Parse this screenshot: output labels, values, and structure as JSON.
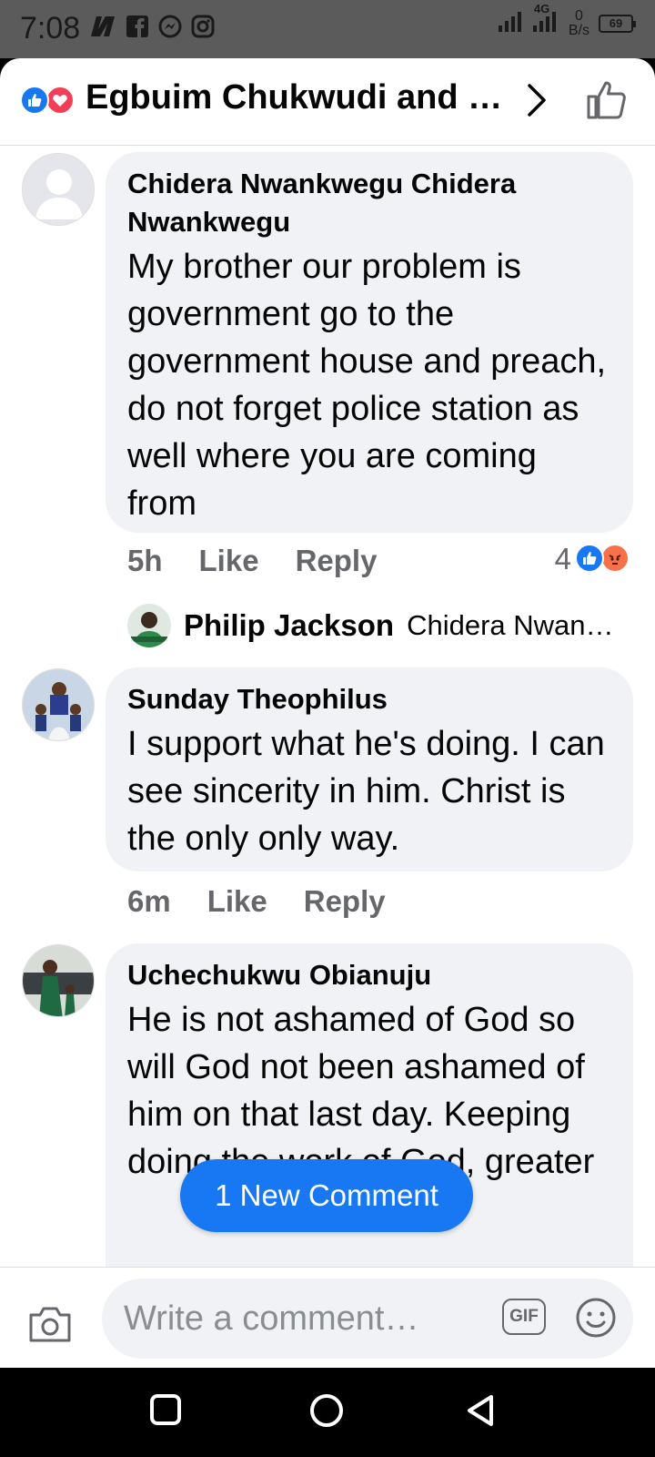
{
  "status_bar": {
    "time": "7:08",
    "network": "4G",
    "rate_value": "0",
    "rate_unit": "B/s",
    "battery": "69"
  },
  "header": {
    "title": "Egbuim Chukwudi and …"
  },
  "comments": [
    {
      "author": "Chidera Nwankwegu Chidera Nwankwegu",
      "text": "My brother our problem is government go to the government house and preach, do not forget police station as well where you are coming from",
      "time": "5h",
      "like_label": "Like",
      "reply_label": "Reply",
      "reaction_count": "4",
      "reply_preview": {
        "author": "Philip Jackson",
        "snippet": "Chidera Nwan…"
      }
    },
    {
      "author": "Sunday Theophilus",
      "text": "I support what he's doing. I can see sincerity in him. Christ is the only only way.",
      "time": "6m",
      "like_label": "Like",
      "reply_label": "Reply"
    },
    {
      "author": "Uchechukwu Obianuju",
      "text": "He is not ashamed of God so will God not been ashamed of him on that last day. Keeping doing the work of God, greater"
    }
  ],
  "new_comment_label": "1 New Comment",
  "composer": {
    "placeholder": "Write a comment…",
    "gif_label": "GIF"
  },
  "colors": {
    "accent": "#1877f2",
    "bubble": "#f0f2f5",
    "muted_text": "#65676b"
  }
}
